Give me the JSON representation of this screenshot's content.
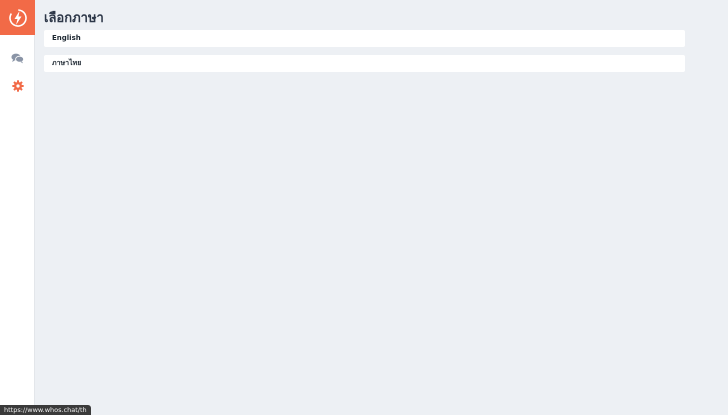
{
  "sidebar": {
    "logo_icon": "bolt-logo-icon",
    "brand_color": "#f26a47",
    "nav": [
      {
        "icon": "chat-bubbles-icon",
        "color": "#8a94a6"
      },
      {
        "icon": "gear-icon",
        "color": "#f26a47"
      }
    ]
  },
  "main": {
    "title": "เลือกภาษา",
    "languages": [
      {
        "label": "English"
      },
      {
        "label": "ภาษาไทย"
      }
    ]
  },
  "status_bar": {
    "url": "https://www.whos.chat/th"
  }
}
